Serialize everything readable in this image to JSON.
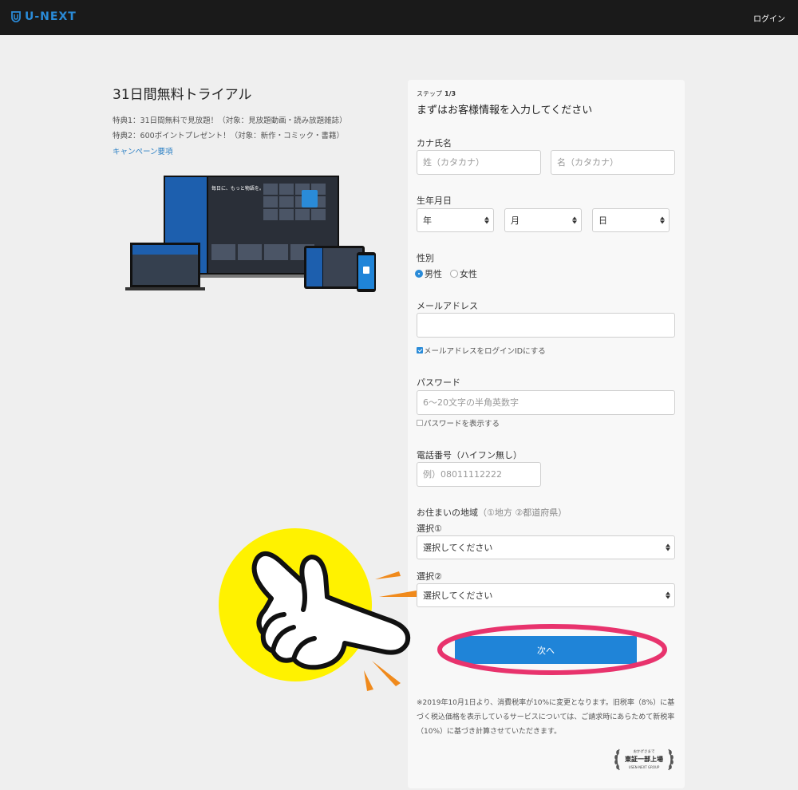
{
  "header": {
    "brand": "U-NEXT",
    "login_label": "ログイン"
  },
  "promo": {
    "title": "31日間無料トライアル",
    "perk1": "特典1：31日間無料で見放題！（対象：見放題動画・読み放題雑誌）",
    "perk2": "特典2：600ポイントプレゼント！（対象：新作・コミック・書籍）",
    "campaign_link": "キャンペーン要項",
    "device_headline": "毎日に、もっと物語を。"
  },
  "form": {
    "step_label": "ステップ",
    "step_value": "1/3",
    "heading": "まずはお客様情報を入力してください",
    "kana_label": "カナ氏名",
    "last_name_placeholder": "姓（カタカナ）",
    "first_name_placeholder": "名（カタカナ）",
    "birth_label": "生年月日",
    "year_label": "年",
    "month_label": "月",
    "day_label": "日",
    "gender_label": "性別",
    "male_label": "男性",
    "female_label": "女性",
    "email_label": "メールアドレス",
    "email_value": "",
    "email_as_login_label": "メールアドレスをログインIDにする",
    "password_label": "パスワード",
    "password_placeholder": "6〜20文字の半角英数字",
    "show_password_label": "パスワードを表示する",
    "phone_label": "電話番号（ハイフン無し）",
    "phone_placeholder": "例）08011112222",
    "region_label": "お住まいの地域",
    "region_hint": "（①地方 ②都道府県）",
    "select1_label": "選択①",
    "select1_value": "選択してください",
    "select2_label": "選択②",
    "select2_value": "選択してください",
    "next_label": "次へ",
    "tax_note": "※2019年10月1日より、消費税率が10%に変更となります。旧税率（8%）に基づく税込価格を表示しているサービスについては、ご請求時にあらためて新税率（10%）に基づき計算させていただきます。",
    "badge_top": "おかげさまで",
    "badge_main": "東証一部上場",
    "badge_sub": "USEN-NEXT GROUP"
  },
  "colors": {
    "accent": "#1f84d8",
    "header_bg": "#1a1a1a",
    "highlight_ellipse": "#e8336d",
    "hand_circle": "#fff200",
    "spark": "#f08a1c"
  }
}
